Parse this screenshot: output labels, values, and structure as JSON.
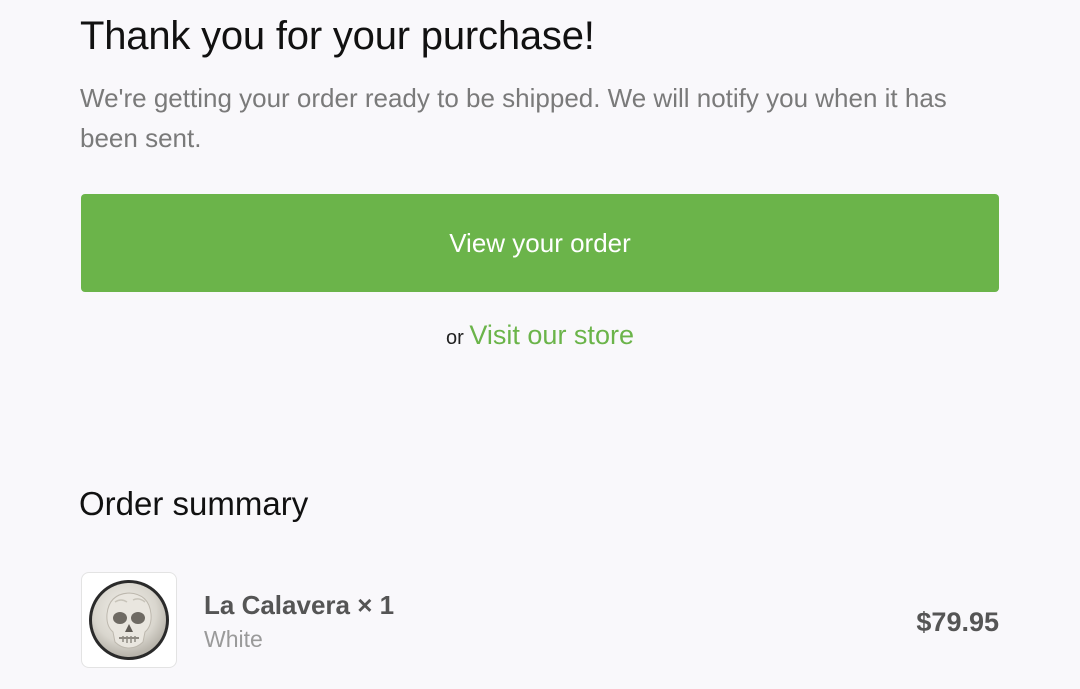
{
  "header": {
    "title": "Thank you for your purchase!",
    "message": "We're getting your order ready to be shipped. We will notify you when it has been sent."
  },
  "actions": {
    "view_order_label": "View your order",
    "or_label": "or",
    "visit_store_label": "Visit our store"
  },
  "summary": {
    "title": "Order summary",
    "items": [
      {
        "name": "La Calavera × 1",
        "variant": "White",
        "price": "$79.95",
        "thumbnail_icon": "skull-icon"
      }
    ]
  },
  "colors": {
    "accent": "#6bb44a",
    "background": "#f9f8fb"
  }
}
